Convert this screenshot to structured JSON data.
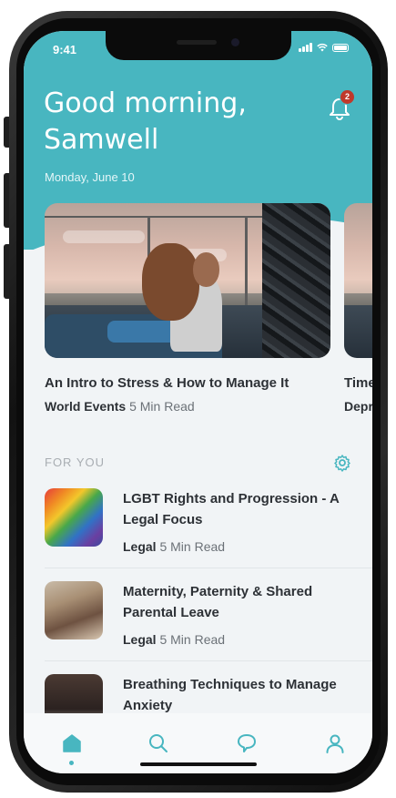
{
  "status_bar": {
    "time": "9:41"
  },
  "header": {
    "greeting": "Good morning, Samwell",
    "date": "Monday, June 10",
    "notification_count": "2"
  },
  "featured": [
    {
      "title": "An Intro to Stress & How to Manage It",
      "category": "World Events",
      "read_time": "5 Min Read"
    },
    {
      "title": "Time",
      "category": "Depr",
      "read_time": ""
    }
  ],
  "for_you": {
    "label": "FOR YOU",
    "items": [
      {
        "title": "LGBT Rights and Progression - A Legal Focus",
        "category": "Legal",
        "read_time": "5 Min Read"
      },
      {
        "title": "Maternity, Paternity & Shared Parental Leave",
        "category": "Legal",
        "read_time": "5 Min Read"
      },
      {
        "title": "Breathing Techniques to Manage Anxiety",
        "category": "",
        "read_time": ""
      }
    ]
  },
  "nav": {
    "items": [
      {
        "icon": "home-icon",
        "active": true
      },
      {
        "icon": "search-icon",
        "active": false
      },
      {
        "icon": "chat-icon",
        "active": false
      },
      {
        "icon": "profile-icon",
        "active": false
      }
    ]
  },
  "colors": {
    "accent": "#48b6c0",
    "text_dark": "#2d3136",
    "text_muted": "#6b7177",
    "badge": "#c0392b"
  }
}
